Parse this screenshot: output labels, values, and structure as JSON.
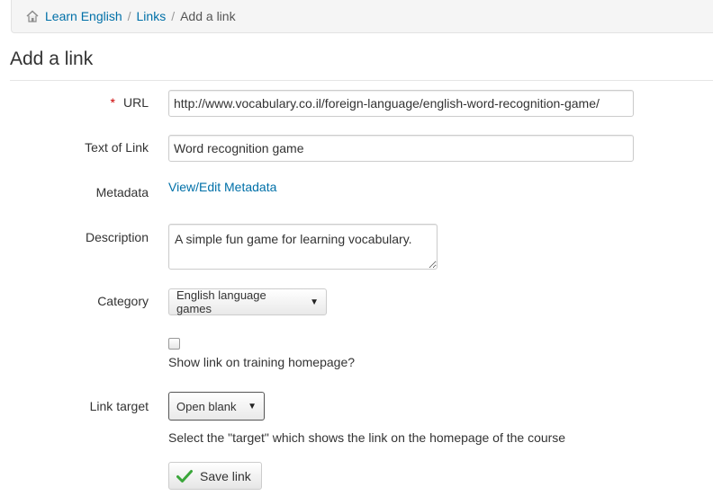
{
  "breadcrumb": {
    "home_icon": "home-icon",
    "items": [
      "Learn English",
      "Links",
      "Add a link"
    ],
    "separator": "/"
  },
  "page_title": "Add a link",
  "form": {
    "url": {
      "label": "URL",
      "required_mark": "*",
      "value": "http://www.vocabulary.co.il/foreign-language/english-word-recognition-game/"
    },
    "text_of_link": {
      "label": "Text of Link",
      "value": "Word recognition game"
    },
    "metadata": {
      "label": "Metadata",
      "link_text": "View/Edit Metadata"
    },
    "description": {
      "label": "Description",
      "value": "A simple fun game for learning vocabulary."
    },
    "category": {
      "label": "Category",
      "selected": "English language games"
    },
    "show_on_homepage": {
      "checked": false,
      "label": "Show link on training homepage?"
    },
    "link_target": {
      "label": "Link target",
      "selected": "Open blank",
      "help": "Select the \"target\" which shows the link on the homepage of the course"
    },
    "save_button": {
      "label": "Save link",
      "icon": "check-icon"
    }
  },
  "colors": {
    "link": "#0070a8",
    "required": "#cc0000",
    "check_icon": "#3aa63a"
  }
}
